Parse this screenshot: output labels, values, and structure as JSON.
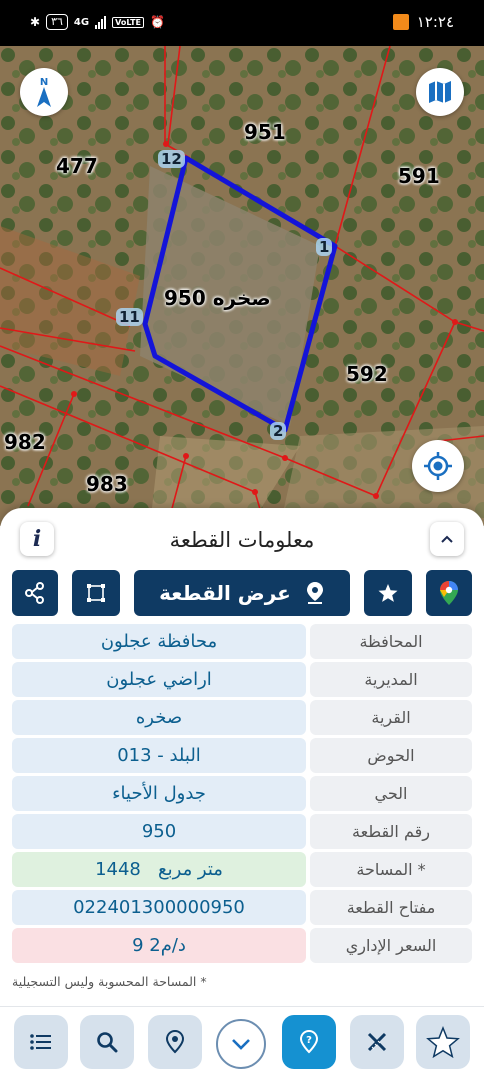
{
  "status_bar": {
    "time": "١٢:٢٤",
    "battery": "٣٦",
    "network": "4G",
    "volte": "VoLTE"
  },
  "map": {
    "compass_label": "N",
    "parcels": [
      {
        "id": "p951",
        "label": "951"
      },
      {
        "id": "p477",
        "label": "477"
      },
      {
        "id": "p591",
        "label": "591"
      },
      {
        "id": "p950",
        "label": "صخره 950"
      },
      {
        "id": "p592",
        "label": "592"
      },
      {
        "id": "p982",
        "label": "982"
      },
      {
        "id": "p983",
        "label": "983"
      }
    ],
    "vertices": [
      "12",
      "1",
      "11",
      "2"
    ]
  },
  "panel": {
    "title": "معلومات القطعة",
    "info_icon": "i",
    "show_parcel_label": "عرض القطعة"
  },
  "details": [
    {
      "label": "المحافظة",
      "value": "محافظة عجلون",
      "tone": "blue"
    },
    {
      "label": "المديرية",
      "value": "اراضي عجلون",
      "tone": "blue"
    },
    {
      "label": "القرية",
      "value": "صخره",
      "tone": "blue"
    },
    {
      "label": "الحوض",
      "value": "البلد - 013",
      "tone": "blue"
    },
    {
      "label": "الحي",
      "value": "جدول الأحياء",
      "tone": "blue"
    },
    {
      "label": "رقم القطعة",
      "value": "950",
      "tone": "blue"
    },
    {
      "label": "المساحة *",
      "value": "1448   متر مربع",
      "tone": "green"
    },
    {
      "label": "مفتاح القطعة",
      "value": "022401300000950",
      "tone": "blue"
    },
    {
      "label": "السعر الإداري",
      "value": "9 د/م2",
      "tone": "red"
    }
  ],
  "footnote": "* المساحة المحسوبة وليس التسجيلية",
  "colors": {
    "primary": "#0f3a63",
    "accent": "#1591d1",
    "parcel_outline": "#1414d8",
    "boundary": "#e01818"
  },
  "icons": {
    "bottom_nav": [
      "list-icon",
      "search-icon",
      "location-pin-icon",
      "chevron-down-icon",
      "question-pin-icon",
      "measure-tools-icon",
      "star-icon"
    ]
  }
}
